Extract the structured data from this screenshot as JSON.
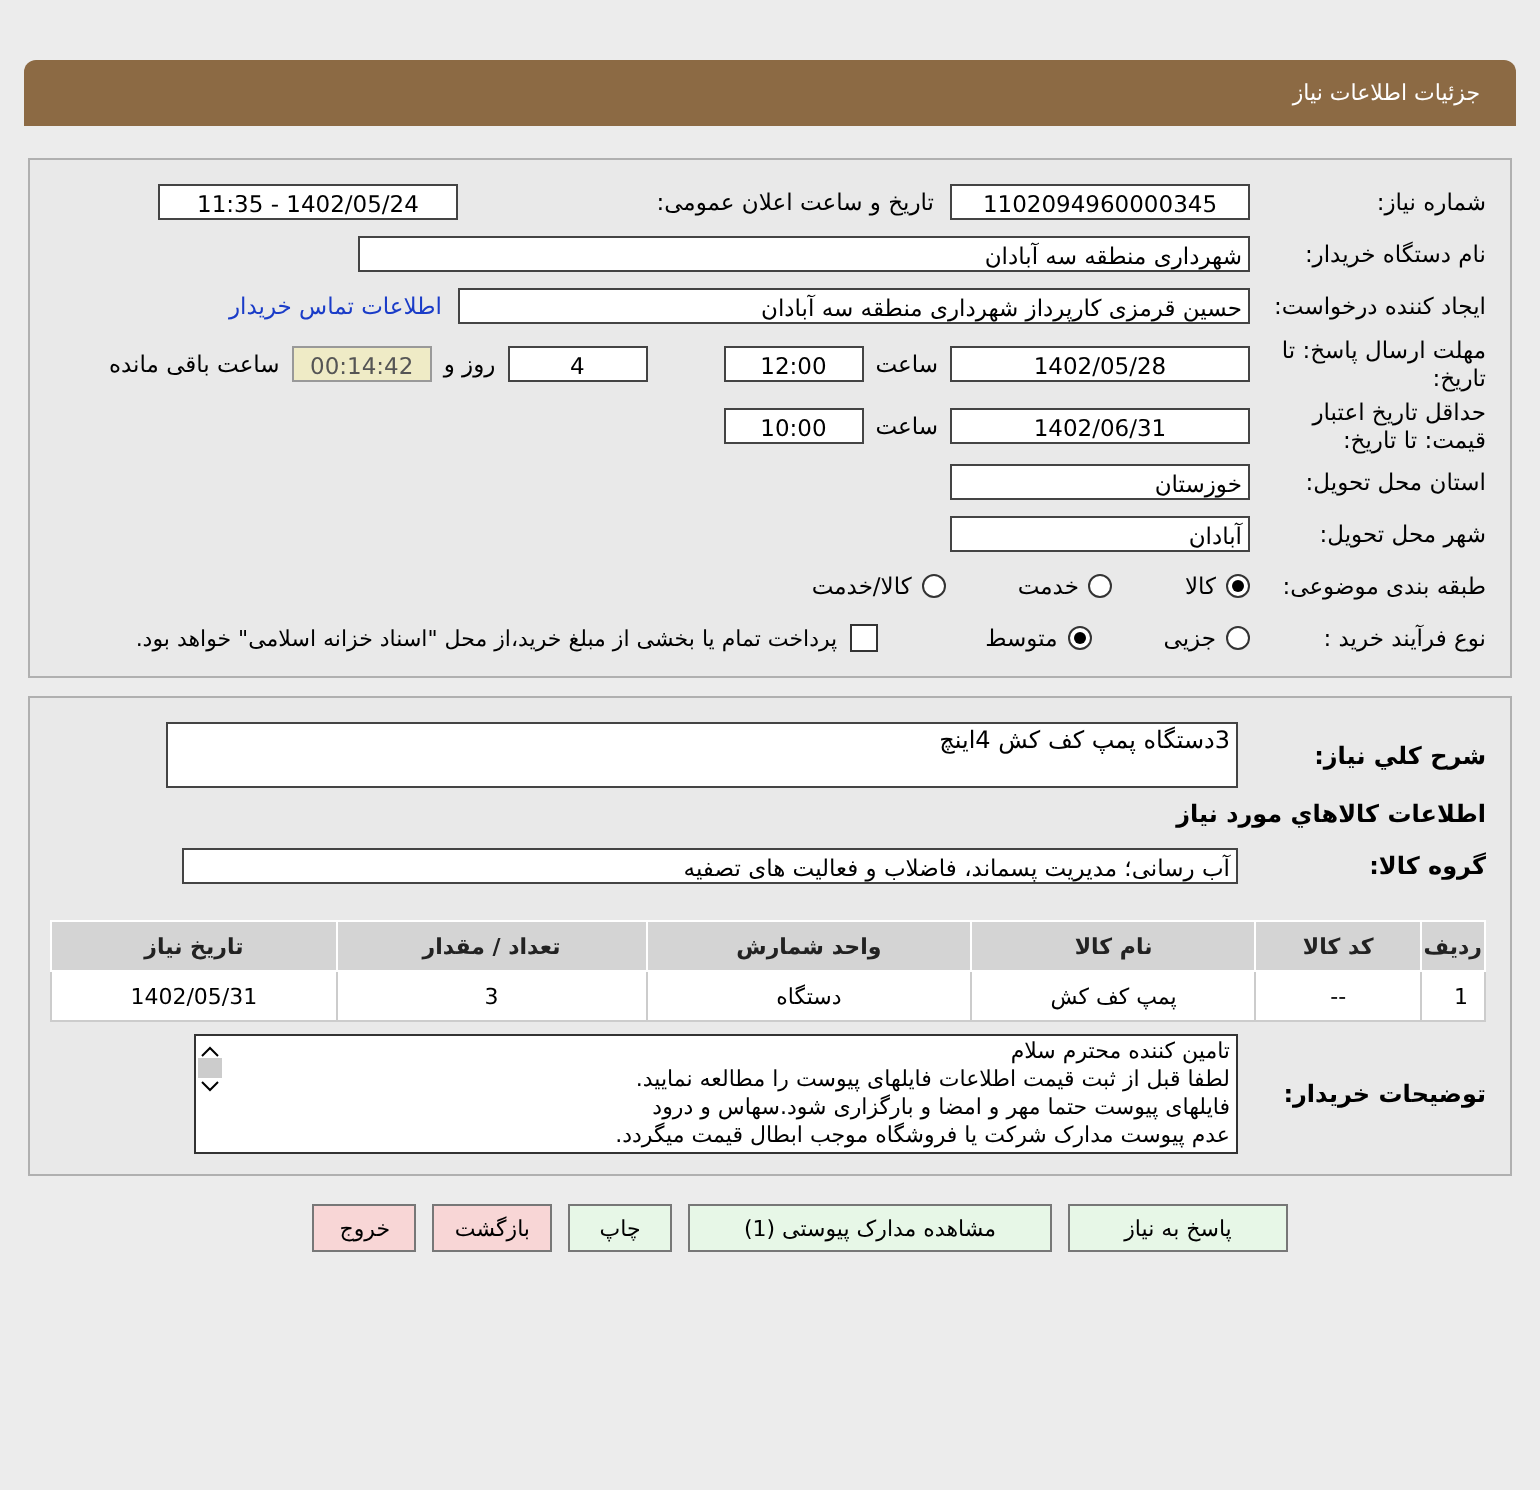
{
  "header": {
    "title": "جزئیات اطلاعات نیاز"
  },
  "need_number": {
    "label": "شماره نیاز:",
    "value": "1102094960000345"
  },
  "announce": {
    "label": "تاریخ و ساعت اعلان عمومی:",
    "value": "1402/05/24 - 11:35"
  },
  "buyer": {
    "label": "نام دستگاه خریدار:",
    "value": "شهرداری منطقه سه آبادان"
  },
  "creator": {
    "label": "ایجاد کننده درخواست:",
    "value": "حسین قرمزی کارپرداز شهرداری منطقه سه آبادان",
    "link": "اطلاعات تماس خریدار"
  },
  "deadline": {
    "label": "مهلت ارسال پاسخ: تا تاریخ:",
    "date": "1402/05/28",
    "time_label": "ساعت",
    "time": "12:00",
    "days": "4",
    "days_label": "روز و",
    "remaining": "00:14:42",
    "remaining_label": "ساعت باقی مانده"
  },
  "validity": {
    "label": "حداقل تاریخ اعتبار قیمت: تا تاریخ:",
    "date": "1402/06/31",
    "time_label": "ساعت",
    "time": "10:00"
  },
  "province": {
    "label": "استان محل تحویل:",
    "value": "خوزستان"
  },
  "city": {
    "label": "شهر محل تحویل:",
    "value": "آبادان"
  },
  "category": {
    "label": "طبقه بندی موضوعی:",
    "options": [
      {
        "label": "کالا",
        "selected": true
      },
      {
        "label": "خدمت",
        "selected": false
      },
      {
        "label": "کالا/خدمت",
        "selected": false
      }
    ]
  },
  "purchase_type": {
    "label": "نوع فرآیند خرید :",
    "options": [
      {
        "label": "جزیی",
        "selected": false
      },
      {
        "label": "متوسط",
        "selected": true
      }
    ],
    "payment": {
      "label": "پرداخت تمام یا بخشی از مبلغ خرید،از محل \"اسناد خزانه اسلامی\" خواهد بود.",
      "checked": false
    }
  },
  "description": {
    "label": "شرح کلي نياز:",
    "value": "3دستگاه پمپ کف کش 4اینچ"
  },
  "goods_heading": "اطلاعات کالاهاي مورد نياز",
  "goods_group": {
    "label": "گروه کالا:",
    "value": "آب رسانی؛ مدیریت پسماند، فاضلاب و فعالیت های تصفیه"
  },
  "table": {
    "columns": [
      "ردیف",
      "کد کالا",
      "نام کالا",
      "واحد شمارش",
      "تعداد / مقدار",
      "تاریخ نیاز"
    ],
    "rows": [
      [
        "1",
        "--",
        "پمپ کف کش",
        "دستگاه",
        "3",
        "1402/05/31"
      ]
    ]
  },
  "notes": {
    "label": "توضیحات خریدار:",
    "lines": [
      "تامین کننده محترم سلام",
      "لطفا قبل از ثبت قیمت اطلاعات فایلهای پیوست را مطالعه نمایید.",
      "فایلهای پیوست حتما مهر و امضا و بارگزاری شود.سهاس و درود",
      "عدم پیوست مدارک شرکت یا فروشگاه موجب ابطال قیمت میگردد."
    ]
  },
  "buttons": [
    {
      "label": "پاسخ به نیاز",
      "kind": "normal"
    },
    {
      "label": "مشاهده مدارک پیوستی (1)",
      "kind": "normal"
    },
    {
      "label": "چاپ",
      "kind": "normal"
    },
    {
      "label": "بازگشت",
      "kind": "danger"
    },
    {
      "label": "خروج",
      "kind": "danger"
    }
  ]
}
